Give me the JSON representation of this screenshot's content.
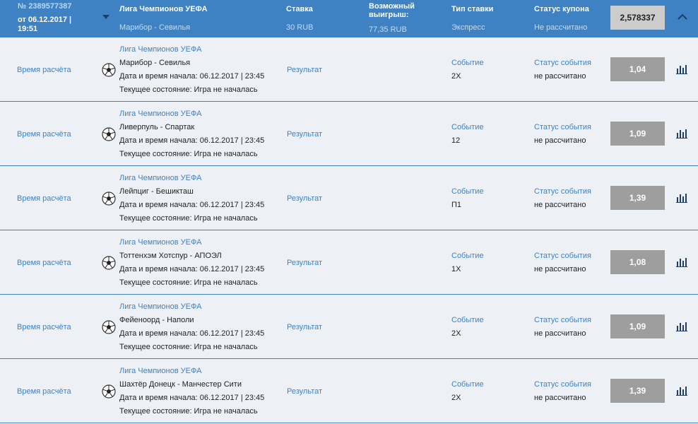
{
  "header": {
    "coupon_number": "№ 2389577387",
    "date_line1": "от 06.12.2017 |",
    "date_line2": "19:51",
    "league": "Лига Чемпионов УЕФА",
    "match": "Марибор - Севилья",
    "stake_label": "Ставка",
    "stake_value": "30 RUB",
    "win_label": "Возможный выигрыш:",
    "win_value": "77,35 RUB",
    "type_label": "Тип ставки",
    "type_value": "Экспресс",
    "status_label": "Статус купона",
    "status_value": "Не рассчитано",
    "total_odds": "2,578337"
  },
  "labels": {
    "calc_time": "Время расчёта",
    "start_prefix": "Дата и время начала: ",
    "state_prefix": "Текущее состояние: ",
    "result": "Результат",
    "event": "Событие",
    "event_status": "Статус события"
  },
  "rows": [
    {
      "league": "Лига Чемпионов УЕФА",
      "teams": "Марибор - Севилья",
      "start": "Дата и время начала: 06.12.2017 | 23:45",
      "state": "Текущее состояние: Игра не началась",
      "event": "2X",
      "status": "не рассчитано",
      "odds": "1,04"
    },
    {
      "league": "Лига Чемпионов УЕФА",
      "teams": "Ливерпуль - Спартак",
      "start": "Дата и время начала: 06.12.2017 | 23:45",
      "state": "Текущее состояние: Игра не началась",
      "event": "12",
      "status": "не рассчитано",
      "odds": "1,09"
    },
    {
      "league": "Лига Чемпионов УЕФА",
      "teams": "Лейпциг - Бешикташ",
      "start": "Дата и время начала: 06.12.2017 | 23:45",
      "state": "Текущее состояние: Игра не началась",
      "event": "П1",
      "status": "не рассчитано",
      "odds": "1,39"
    },
    {
      "league": "Лига Чемпионов УЕФА",
      "teams": "Тоттенхэм Хотспур - АПОЭЛ",
      "start": "Дата и время начала: 06.12.2017 | 23:45",
      "state": "Текущее состояние: Игра не началась",
      "event": "1X",
      "status": "не рассчитано",
      "odds": "1,08"
    },
    {
      "league": "Лига Чемпионов УЕФА",
      "teams": "Фейеноорд - Наполи",
      "start": "Дата и время начала: 06.12.2017 | 23:45",
      "state": "Текущее состояние: Игра не началась",
      "event": "2X",
      "status": "не рассчитано",
      "odds": "1,09"
    },
    {
      "league": "Лига Чемпионов УЕФА",
      "teams": "Шахтёр Донецк - Манчестер Сити",
      "start": "Дата и время начала: 06.12.2017 | 23:45",
      "state": "Текущее состояние: Игра не началась",
      "event": "2X",
      "status": "не рассчитано",
      "odds": "1,39"
    }
  ],
  "colors": {
    "accent": "#3e82c4",
    "row_bg": "#edf1f6",
    "odds_bg": "#9e9e9e"
  },
  "icons": {
    "ball": "football-icon",
    "stats": "bar-chart-icon",
    "collapse": "chevron-up-icon",
    "dropdown": "caret-down-icon"
  }
}
